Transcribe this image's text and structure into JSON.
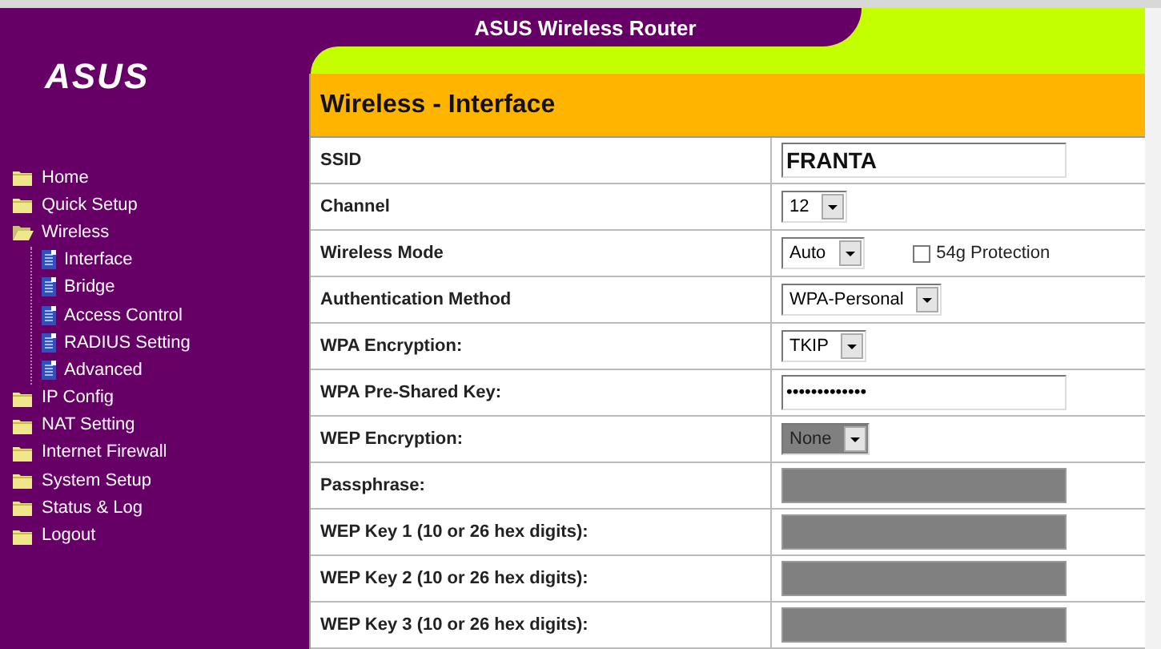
{
  "header": {
    "logo": "ASUS",
    "title": "ASUS Wireless Router"
  },
  "sidebar": {
    "items": [
      {
        "label": "Home",
        "expanded": false
      },
      {
        "label": "Quick Setup",
        "expanded": false
      },
      {
        "label": "Wireless",
        "expanded": true,
        "children": [
          {
            "label": "Interface"
          },
          {
            "label": "Bridge"
          },
          {
            "label": "Access Control"
          },
          {
            "label": "RADIUS Setting"
          },
          {
            "label": "Advanced"
          }
        ]
      },
      {
        "label": "IP Config",
        "expanded": false
      },
      {
        "label": "NAT Setting",
        "expanded": false
      },
      {
        "label": "Internet Firewall",
        "expanded": false
      },
      {
        "label": "System Setup",
        "expanded": false
      },
      {
        "label": "Status & Log",
        "expanded": false
      },
      {
        "label": "Logout",
        "expanded": false
      }
    ]
  },
  "section_title": "Wireless - Interface",
  "rows": [
    {
      "label": "SSID",
      "kind": "text",
      "value": "FRANTA",
      "disabled": false
    },
    {
      "label": "Channel",
      "kind": "select",
      "value": "12",
      "disabled": false
    },
    {
      "label": "Wireless Mode",
      "kind": "select",
      "value": "Auto",
      "disabled": false,
      "checkbox": {
        "label": "54g Protection",
        "checked": false
      }
    },
    {
      "label": "Authentication Method",
      "kind": "select",
      "value": "WPA-Personal",
      "disabled": false
    },
    {
      "label": "WPA Encryption:",
      "kind": "select",
      "value": "TKIP",
      "disabled": false
    },
    {
      "label": "WPA Pre-Shared Key:",
      "kind": "password",
      "value": "•••••••••••••",
      "disabled": false
    },
    {
      "label": "WEP Encryption:",
      "kind": "select",
      "value": "None",
      "disabled": true
    },
    {
      "label": "Passphrase:",
      "kind": "text",
      "disabled": true
    },
    {
      "label": "WEP Key 1 (10 or 26 hex digits):",
      "kind": "text",
      "disabled": true
    },
    {
      "label": "WEP Key 2 (10 or 26 hex digits):",
      "kind": "text",
      "disabled": true
    },
    {
      "label": "WEP Key 3 (10 or 26 hex digits):",
      "kind": "text",
      "disabled": true
    }
  ]
}
